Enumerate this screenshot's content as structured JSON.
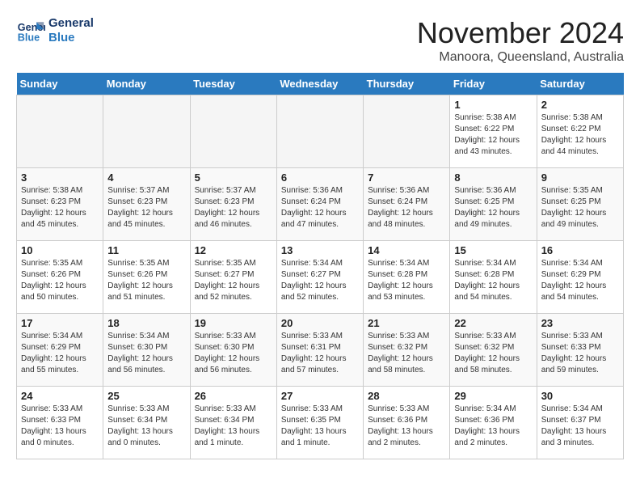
{
  "logo": {
    "line1": "General",
    "line2": "Blue"
  },
  "title": "November 2024",
  "location": "Manoora, Queensland, Australia",
  "days_of_week": [
    "Sunday",
    "Monday",
    "Tuesday",
    "Wednesday",
    "Thursday",
    "Friday",
    "Saturday"
  ],
  "weeks": [
    [
      {
        "num": "",
        "info": ""
      },
      {
        "num": "",
        "info": ""
      },
      {
        "num": "",
        "info": ""
      },
      {
        "num": "",
        "info": ""
      },
      {
        "num": "",
        "info": ""
      },
      {
        "num": "1",
        "info": "Sunrise: 5:38 AM\nSunset: 6:22 PM\nDaylight: 12 hours\nand 43 minutes."
      },
      {
        "num": "2",
        "info": "Sunrise: 5:38 AM\nSunset: 6:22 PM\nDaylight: 12 hours\nand 44 minutes."
      }
    ],
    [
      {
        "num": "3",
        "info": "Sunrise: 5:38 AM\nSunset: 6:23 PM\nDaylight: 12 hours\nand 45 minutes."
      },
      {
        "num": "4",
        "info": "Sunrise: 5:37 AM\nSunset: 6:23 PM\nDaylight: 12 hours\nand 45 minutes."
      },
      {
        "num": "5",
        "info": "Sunrise: 5:37 AM\nSunset: 6:23 PM\nDaylight: 12 hours\nand 46 minutes."
      },
      {
        "num": "6",
        "info": "Sunrise: 5:36 AM\nSunset: 6:24 PM\nDaylight: 12 hours\nand 47 minutes."
      },
      {
        "num": "7",
        "info": "Sunrise: 5:36 AM\nSunset: 6:24 PM\nDaylight: 12 hours\nand 48 minutes."
      },
      {
        "num": "8",
        "info": "Sunrise: 5:36 AM\nSunset: 6:25 PM\nDaylight: 12 hours\nand 49 minutes."
      },
      {
        "num": "9",
        "info": "Sunrise: 5:35 AM\nSunset: 6:25 PM\nDaylight: 12 hours\nand 49 minutes."
      }
    ],
    [
      {
        "num": "10",
        "info": "Sunrise: 5:35 AM\nSunset: 6:26 PM\nDaylight: 12 hours\nand 50 minutes."
      },
      {
        "num": "11",
        "info": "Sunrise: 5:35 AM\nSunset: 6:26 PM\nDaylight: 12 hours\nand 51 minutes."
      },
      {
        "num": "12",
        "info": "Sunrise: 5:35 AM\nSunset: 6:27 PM\nDaylight: 12 hours\nand 52 minutes."
      },
      {
        "num": "13",
        "info": "Sunrise: 5:34 AM\nSunset: 6:27 PM\nDaylight: 12 hours\nand 52 minutes."
      },
      {
        "num": "14",
        "info": "Sunrise: 5:34 AM\nSunset: 6:28 PM\nDaylight: 12 hours\nand 53 minutes."
      },
      {
        "num": "15",
        "info": "Sunrise: 5:34 AM\nSunset: 6:28 PM\nDaylight: 12 hours\nand 54 minutes."
      },
      {
        "num": "16",
        "info": "Sunrise: 5:34 AM\nSunset: 6:29 PM\nDaylight: 12 hours\nand 54 minutes."
      }
    ],
    [
      {
        "num": "17",
        "info": "Sunrise: 5:34 AM\nSunset: 6:29 PM\nDaylight: 12 hours\nand 55 minutes."
      },
      {
        "num": "18",
        "info": "Sunrise: 5:34 AM\nSunset: 6:30 PM\nDaylight: 12 hours\nand 56 minutes."
      },
      {
        "num": "19",
        "info": "Sunrise: 5:33 AM\nSunset: 6:30 PM\nDaylight: 12 hours\nand 56 minutes."
      },
      {
        "num": "20",
        "info": "Sunrise: 5:33 AM\nSunset: 6:31 PM\nDaylight: 12 hours\nand 57 minutes."
      },
      {
        "num": "21",
        "info": "Sunrise: 5:33 AM\nSunset: 6:32 PM\nDaylight: 12 hours\nand 58 minutes."
      },
      {
        "num": "22",
        "info": "Sunrise: 5:33 AM\nSunset: 6:32 PM\nDaylight: 12 hours\nand 58 minutes."
      },
      {
        "num": "23",
        "info": "Sunrise: 5:33 AM\nSunset: 6:33 PM\nDaylight: 12 hours\nand 59 minutes."
      }
    ],
    [
      {
        "num": "24",
        "info": "Sunrise: 5:33 AM\nSunset: 6:33 PM\nDaylight: 13 hours\nand 0 minutes."
      },
      {
        "num": "25",
        "info": "Sunrise: 5:33 AM\nSunset: 6:34 PM\nDaylight: 13 hours\nand 0 minutes."
      },
      {
        "num": "26",
        "info": "Sunrise: 5:33 AM\nSunset: 6:34 PM\nDaylight: 13 hours\nand 1 minute."
      },
      {
        "num": "27",
        "info": "Sunrise: 5:33 AM\nSunset: 6:35 PM\nDaylight: 13 hours\nand 1 minute."
      },
      {
        "num": "28",
        "info": "Sunrise: 5:33 AM\nSunset: 6:36 PM\nDaylight: 13 hours\nand 2 minutes."
      },
      {
        "num": "29",
        "info": "Sunrise: 5:34 AM\nSunset: 6:36 PM\nDaylight: 13 hours\nand 2 minutes."
      },
      {
        "num": "30",
        "info": "Sunrise: 5:34 AM\nSunset: 6:37 PM\nDaylight: 13 hours\nand 3 minutes."
      }
    ]
  ]
}
